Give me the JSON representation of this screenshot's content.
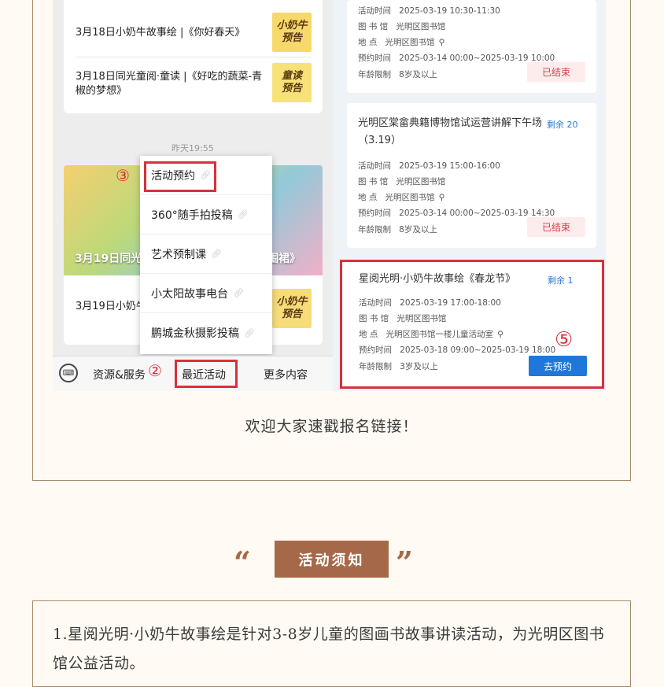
{
  "left_chat": {
    "items_top": [
      {
        "text": "3月18日小奶牛故事绘 |《你好春天》",
        "tag": "小奶牛\n预告"
      },
      {
        "text": "3月18日同光童阅·童读 |《好吃的蔬菜-青椒的梦想》",
        "tag": "童读\n预告"
      }
    ],
    "timestamp": "昨天19:55",
    "banner_caption_left": "3月19日同光",
    "banner_caption_right": "围裙》",
    "bottom_item": {
      "text": "3月19日小奶牛",
      "tag": "小奶牛\n预告"
    },
    "menu": [
      "活动预约",
      "360°随手拍投稿",
      "艺术预制课",
      "小太阳故事电台",
      "鹏城金秋摄影投稿"
    ],
    "bottom_bar": {
      "tab1": "资源&服务",
      "tab2": "最近活动",
      "tab3": "更多内容"
    },
    "markers": {
      "m2": "②",
      "m3": "③",
      "m5": "⑤"
    }
  },
  "events": [
    {
      "title": "",
      "remaining": "",
      "rows": [
        {
          "label": "活动时间",
          "value": "2025-03-19 10:30-11:30"
        },
        {
          "label": "图 书 馆",
          "value": "光明区图书馆"
        },
        {
          "label": "地     点",
          "value": "光明区图书馆"
        },
        {
          "label": "预约时间",
          "value": "2025-03-14 00:00~2025-03-19 10:00"
        },
        {
          "label": "年龄限制",
          "value": "8岁及以上"
        }
      ],
      "status": "已结束"
    },
    {
      "title": "光明区棠畲典籍博物馆试运营讲解下午场（3.19）",
      "remaining": "剩余 20",
      "rows": [
        {
          "label": "活动时间",
          "value": "2025-03-19 15:00-16:00"
        },
        {
          "label": "图 书 馆",
          "value": "光明区图书馆"
        },
        {
          "label": "地     点",
          "value": "光明区图书馆"
        },
        {
          "label": "预约时间",
          "value": "2025-03-14 00:00~2025-03-19 14:30"
        },
        {
          "label": "年龄限制",
          "value": "8岁及以上"
        }
      ],
      "status": "已结束"
    },
    {
      "title": "星阅光明·小奶牛故事绘《春龙节》",
      "remaining": "剩余 1",
      "rows": [
        {
          "label": "活动时间",
          "value": "2025-03-19 17:00-18:00"
        },
        {
          "label": "图 书 馆",
          "value": "光明区图书馆"
        },
        {
          "label": "地     点",
          "value": "光明区图书馆一楼儿童活动室"
        },
        {
          "label": "预约时间",
          "value": "2025-03-18 09:00~2025-03-19 18:00"
        },
        {
          "label": "年龄限制",
          "value": "3岁及以上"
        }
      ],
      "status": "去预约"
    }
  ],
  "caption": "欢迎大家速戳报名链接！",
  "section": {
    "open_quote": "“",
    "title": "活动须知",
    "close_quote": "”"
  },
  "notice_text": "1.星阅光明·小奶牛故事绘是针对3-8岁儿童的图画书故事讲读活动，为光明区图书馆公益活动。",
  "colors": {
    "accent": "#a5694a",
    "highlight": "#d8303d",
    "link_blue": "#1f78d9"
  }
}
